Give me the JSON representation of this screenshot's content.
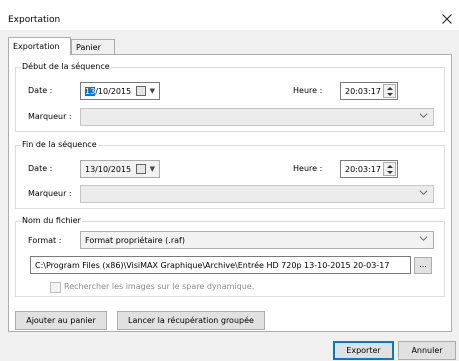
{
  "window": {
    "title": "Exportation"
  },
  "tabs": [
    {
      "label": "Exportation",
      "active": true
    },
    {
      "label": "Panier",
      "active": false
    }
  ],
  "debut": {
    "group_title": "Début de la séquence",
    "date_label": "Date :",
    "date_day_selected": "13",
    "date_rest": "/10/2015",
    "heure_label": "Heure :",
    "heure_value": "20:03:17",
    "marqueur_label": "Marqueur :",
    "marqueur_value": ""
  },
  "fin": {
    "group_title": "Fin de la séquence",
    "date_label": "Date :",
    "date_value": "13/10/2015",
    "heure_label": "Heure :",
    "heure_value": "20:03:17",
    "marqueur_label": "Marqueur :",
    "marqueur_value": ""
  },
  "fichier": {
    "group_title": "Nom du fichier",
    "format_label": "Format :",
    "format_value": "Format propriétaire (.raf)",
    "path_value": "C:\\Program Files (x86)\\VisiMAX Graphique\\Archive\\Entrée HD 720p 13-10-2015 20-03-17",
    "browse_label": "...",
    "spare_checkbox_label": "Rechercher les images sur le spare dynamique.",
    "spare_checked": false
  },
  "actions": {
    "add_cart": "Ajouter au panier",
    "batch_recovery": "Lancer la récupération groupée"
  },
  "footer": {
    "export": "Exporter",
    "cancel": "Annuler"
  }
}
